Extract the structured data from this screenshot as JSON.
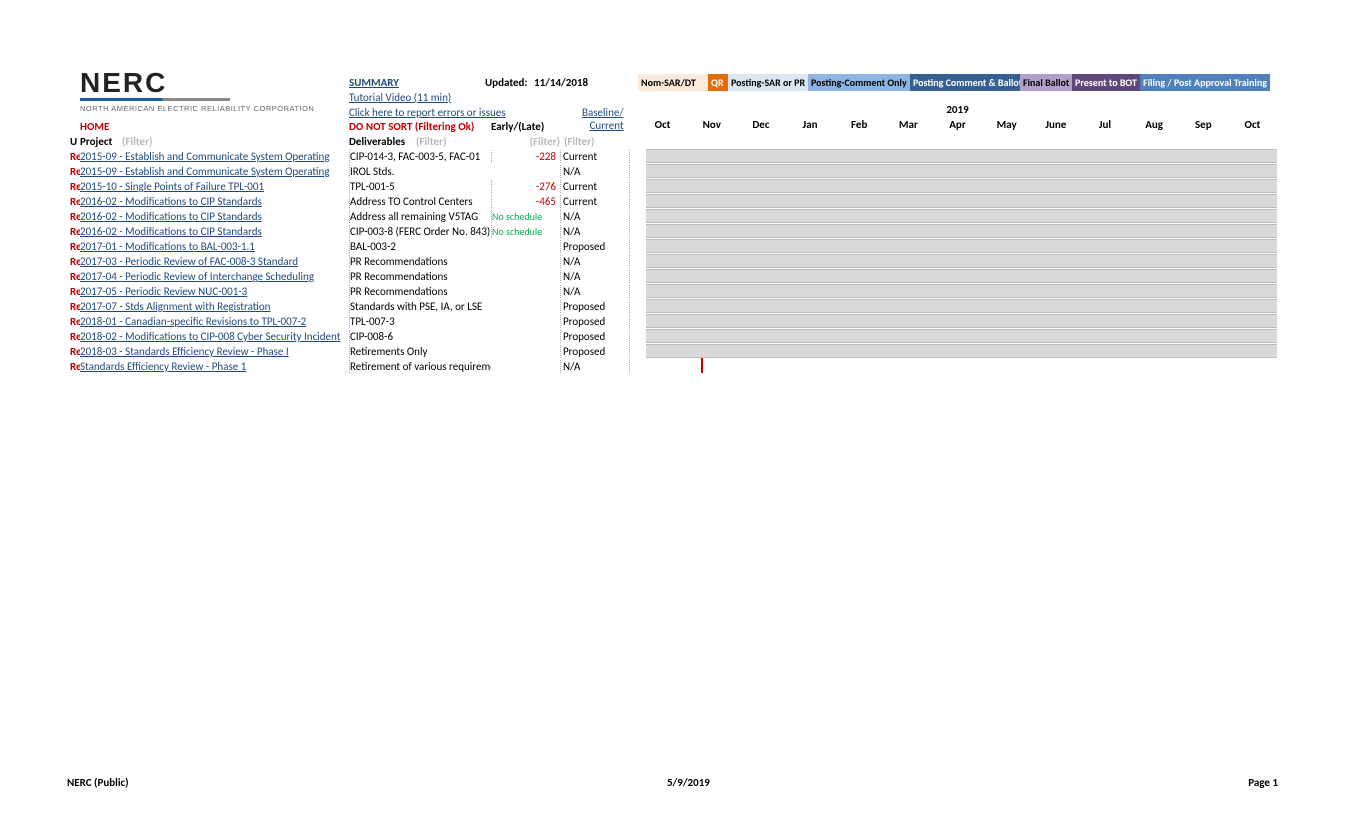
{
  "logo": {
    "title": "NERC",
    "sub": "NORTH AMERICAN ELECTRIC RELIABILITY CORPORATION"
  },
  "header": {
    "summary": "SUMMARY",
    "tutorial": "Tutorial Video (11 min)",
    "report": "Click here to report errors or issues",
    "updated_label": "Updated:",
    "updated_date": "11/14/2018",
    "baseline": "Baseline/",
    "current": "Current",
    "home": "HOME",
    "nosort": "DO NOT SORT (Filtering Ok)",
    "earlylate": "Early/(Late)"
  },
  "legend": {
    "nom": "Nom-SAR/DT",
    "qr": "QR",
    "postsar": "Posting-SAR or PR",
    "postcom": "Posting-Comment Only",
    "postbal": "Posting Comment & Ballot",
    "finalb": "Final Ballot",
    "present": "Present to BOT",
    "filing": "Filing / Post Approval Training"
  },
  "year": "2019",
  "months": [
    "Oct",
    "Nov",
    "Dec",
    "Jan",
    "Feb",
    "Mar",
    "Apr",
    "May",
    "June",
    "Jul",
    "Aug",
    "Sep",
    "Oct"
  ],
  "colheads": {
    "u": "U",
    "project": "Project",
    "deliverables": "Deliverables",
    "filter": "(Filter)"
  },
  "rows": [
    {
      "p": "Re",
      "project": "2015-09 - Establish and Communicate System Operating",
      "deliv": "CIP-014-3, FAC-003-5, FAC-01",
      "early": "-228",
      "neg": true,
      "status": "Current"
    },
    {
      "p": "Re",
      "project": "2015-09 - Establish and Communicate System Operating",
      "deliv": "IROL Stds.",
      "early": "",
      "status": "N/A"
    },
    {
      "p": "Re",
      "project": "2015-10 - Single Points of Failure TPL-001",
      "deliv": "TPL-001-5",
      "early": "-276",
      "neg": true,
      "status": "Current"
    },
    {
      "p": "Re",
      "project": "2016-02 - Modifications to CIP Standards",
      "deliv": "Address TO Control Centers",
      "early": "-465",
      "neg": true,
      "status": "Current"
    },
    {
      "p": "Re",
      "project": "2016-02 - Modifications to CIP Standards",
      "deliv": "Address all remaining V5TAG",
      "early": "No schedule",
      "nosched": true,
      "status": "N/A"
    },
    {
      "p": "Re",
      "project": "2016-02 - Modifications to CIP Standards",
      "deliv": "CIP-003-8 (FERC Order No. 843)",
      "early": "No schedule",
      "nosched": true,
      "status": "N/A"
    },
    {
      "p": "Re",
      "project": "2017-01 - Modifications to BAL-003-1.1",
      "deliv": "BAL-003-2",
      "early": "",
      "status": "Proposed"
    },
    {
      "p": "Re",
      "project": "2017-03 - Periodic Review of FAC-008-3 Standard",
      "deliv": "PR Recommendations",
      "early": "",
      "status": "N/A"
    },
    {
      "p": "Re",
      "project": "2017-04 - Periodic Review of Interchange Scheduling",
      "deliv": "PR Recommendations",
      "early": "",
      "status": "N/A"
    },
    {
      "p": "Re",
      "project": "2017-05 - Periodic Review NUC-001-3",
      "deliv": "PR Recommendations",
      "early": "",
      "status": "N/A"
    },
    {
      "p": "Re",
      "project": "2017-07 - Stds Alignment with Registration",
      "deliv": "Standards with PSE, IA, or LSE",
      "early": "",
      "status": "Proposed"
    },
    {
      "p": "Re",
      "project": "2018-01 - Canadian-specific Revisions to TPL-007-2",
      "deliv": "TPL-007-3",
      "early": "",
      "status": "Proposed"
    },
    {
      "p": "Re",
      "project": "2018-02 - Modifications to CIP-008 Cyber Security Incident",
      "deliv": "CIP-008-6",
      "early": "",
      "status": "Proposed"
    },
    {
      "p": "Re",
      "project": "2018-03 - Standards Efficiency Review - Phase I",
      "deliv": "Retirements Only",
      "early": "",
      "status": "Proposed"
    },
    {
      "p": "Re",
      "project": "Standards Efficiency Review - Phase 1",
      "deliv": "Retirement of various requirements",
      "early": "",
      "status": "N/A",
      "last": true
    }
  ],
  "footer": {
    "left": "NERC (Public)",
    "center": "5/9/2019",
    "right": "Page 1"
  }
}
